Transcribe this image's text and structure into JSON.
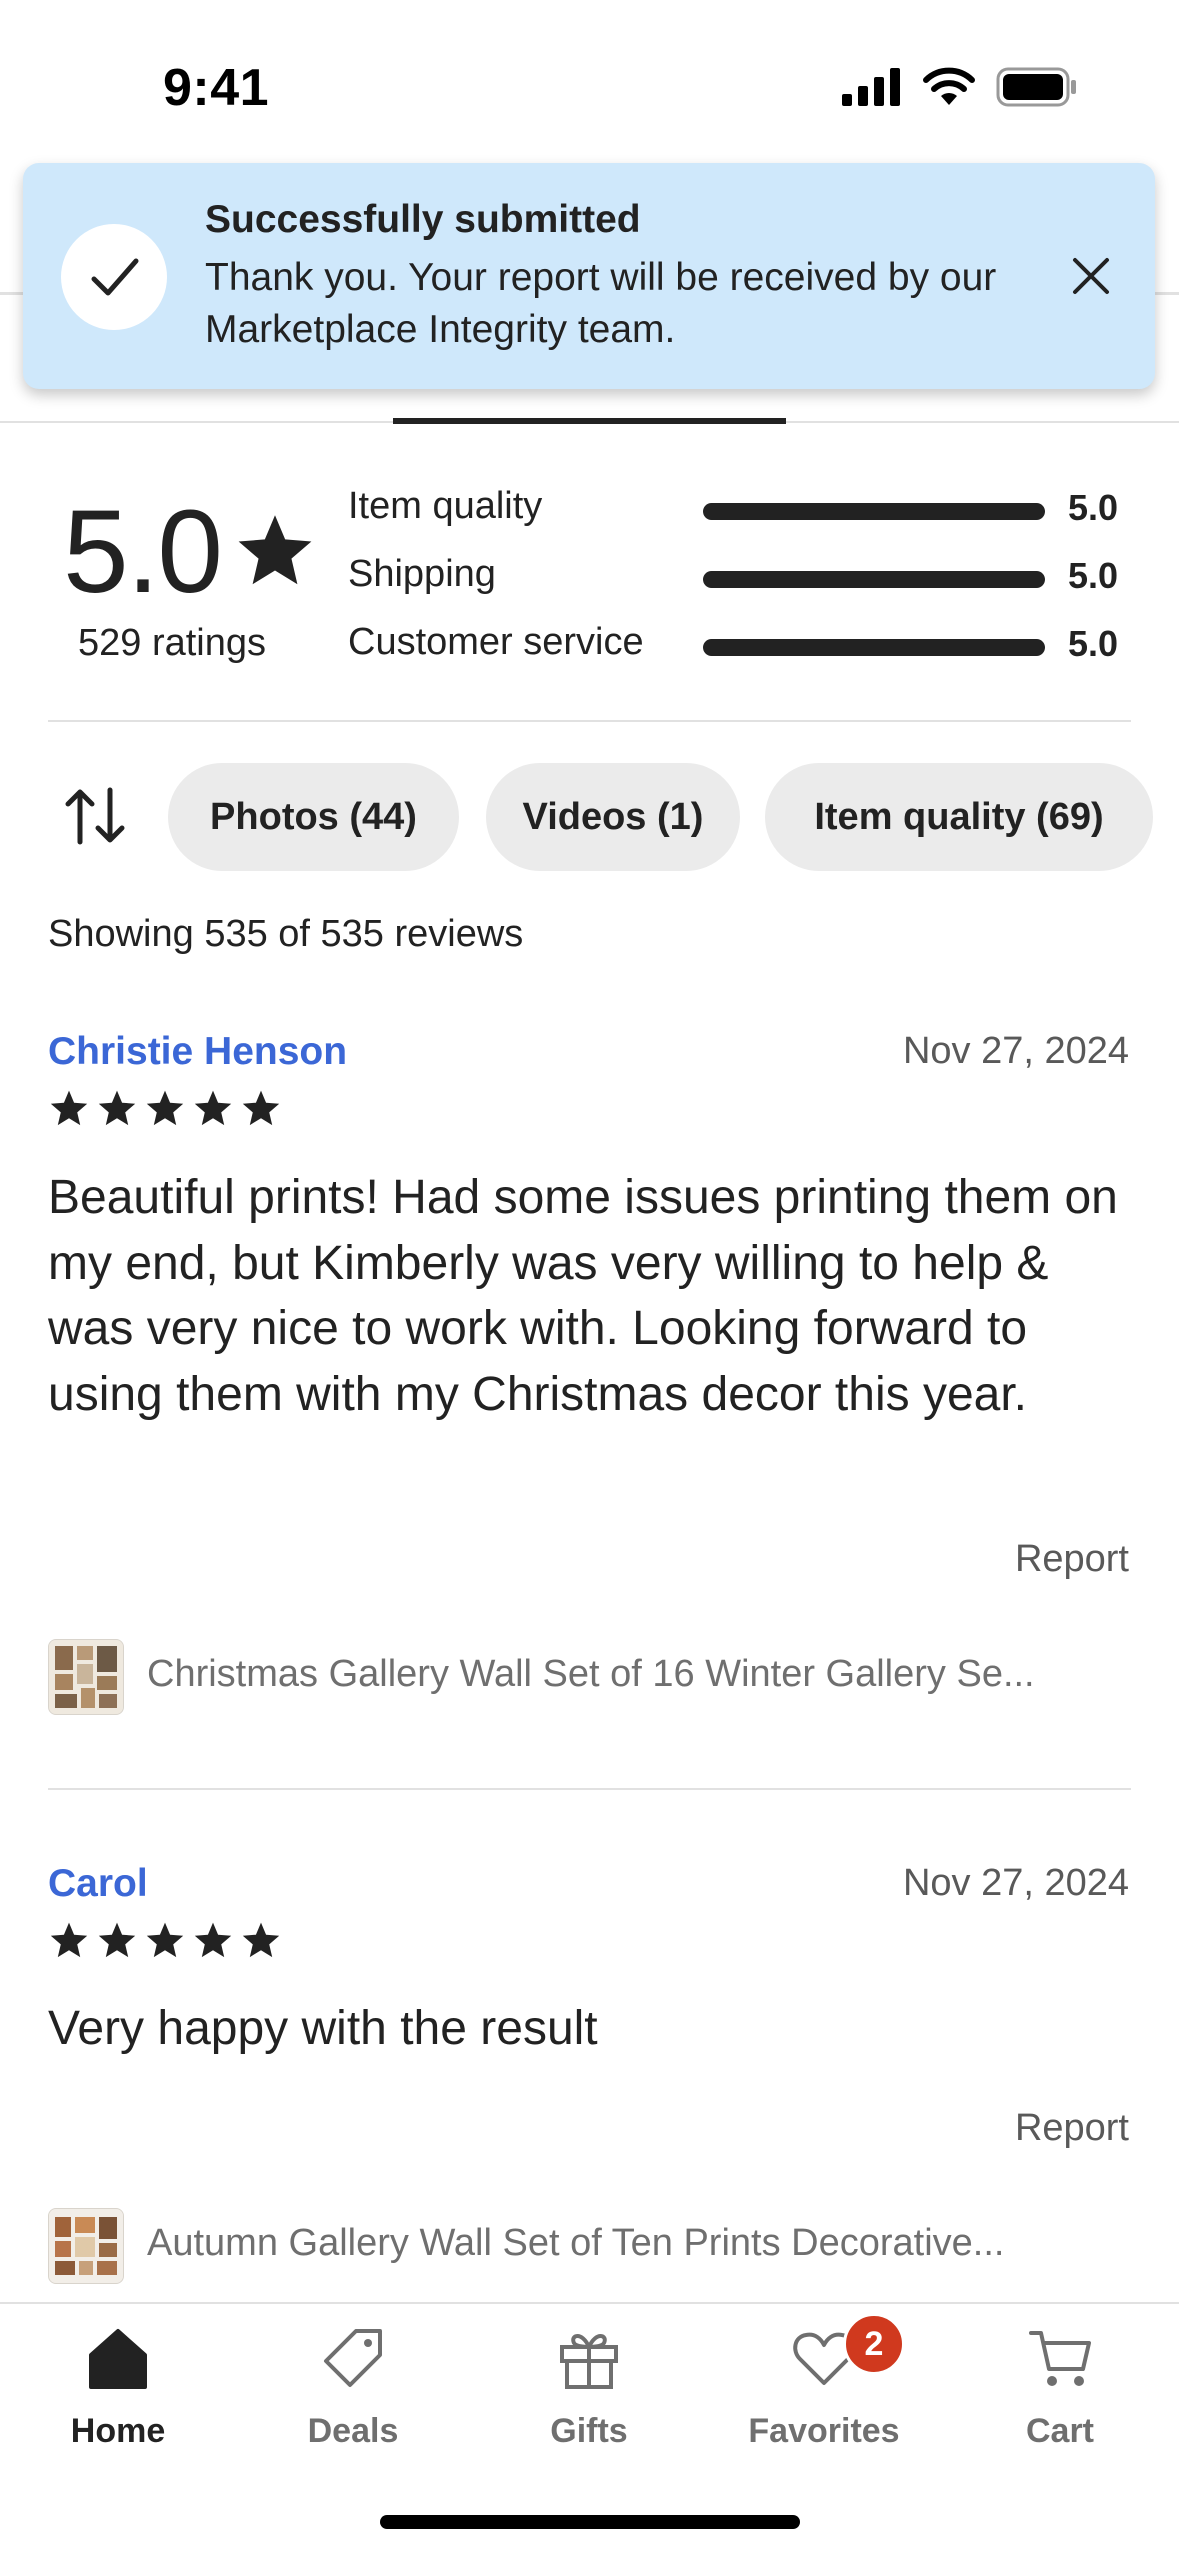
{
  "status_bar": {
    "time": "9:41"
  },
  "toast": {
    "title": "Successfully submitted",
    "message": "Thank you. Your report will be received by our Marketplace Integrity team.",
    "icon": "check-icon",
    "close_icon": "close-icon"
  },
  "ratings": {
    "average": "5.0",
    "count_label": "529 ratings",
    "categories": [
      {
        "label": "Item quality",
        "value": "5.0",
        "fraction": 1.0
      },
      {
        "label": "Shipping",
        "value": "5.0",
        "fraction": 1.0
      },
      {
        "label": "Customer service",
        "value": "5.0",
        "fraction": 1.0
      }
    ]
  },
  "filters": {
    "sort_icon": "sort-icon",
    "chips": [
      "Photos (44)",
      "Videos (1)",
      "Item quality (69)"
    ]
  },
  "showing_label": "Showing 535 of 535 reviews",
  "reviews": [
    {
      "reviewer": "Christie Henson",
      "date": "Nov 27, 2024",
      "stars": 5,
      "text": "Beautiful prints! Had some issues printing them on my end, but Kimberly was very willing to help & was very nice to work with. Looking forward to using them with my Christmas decor this year.",
      "report_label": "Report",
      "item_title": "Christmas Gallery Wall Set of 16 Winter Gallery Se..."
    },
    {
      "reviewer": "Carol",
      "date": "Nov 27, 2024",
      "stars": 5,
      "text": "Very happy with the result",
      "report_label": "Report",
      "item_title": "Autumn Gallery Wall Set of Ten Prints Decorative..."
    }
  ],
  "bottom_nav": {
    "items": [
      {
        "label": "Home",
        "icon": "home-icon",
        "active": true
      },
      {
        "label": "Deals",
        "icon": "tag-icon",
        "active": false
      },
      {
        "label": "Gifts",
        "icon": "gift-icon",
        "active": false
      },
      {
        "label": "Favorites",
        "icon": "heart-icon",
        "active": false,
        "badge": "2"
      },
      {
        "label": "Cart",
        "icon": "cart-icon",
        "active": false
      }
    ]
  },
  "colors": {
    "toast_bg": "#cfe8fb",
    "reviewer_link": "#3b67d6",
    "badge": "#d0391e",
    "text": "#222222"
  }
}
